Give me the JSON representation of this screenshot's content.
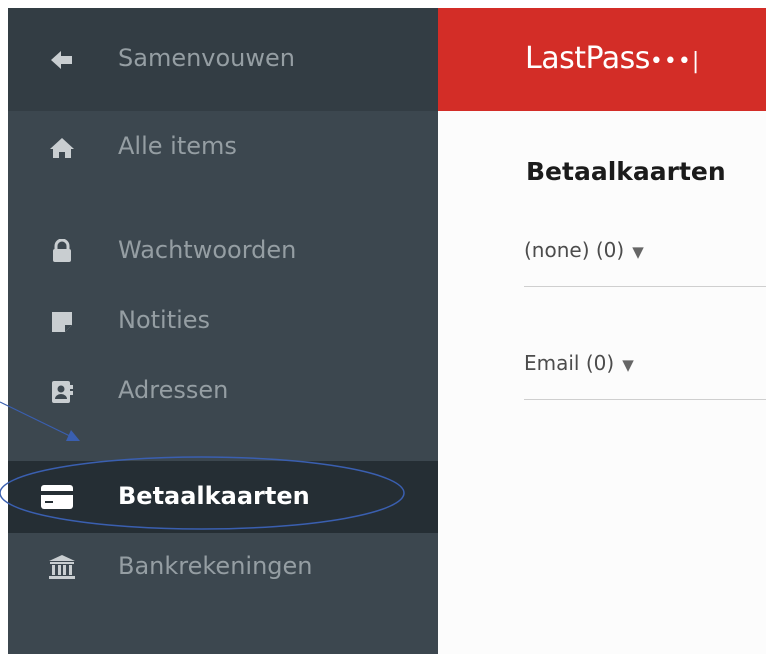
{
  "sidebar": {
    "collapse_label": "Samenvouwen",
    "items": [
      {
        "label": "Alle items",
        "icon": "home-icon"
      },
      {
        "label": "Wachtwoorden",
        "icon": "lock-icon"
      },
      {
        "label": "Notities",
        "icon": "note-icon"
      },
      {
        "label": "Adressen",
        "icon": "address-book-icon"
      },
      {
        "label": "Betaalkaarten",
        "icon": "credit-card-icon",
        "active": true
      },
      {
        "label": "Bankrekeningen",
        "icon": "bank-icon"
      }
    ]
  },
  "header": {
    "logo_text": "LastPass",
    "logo_suffix": "•••|"
  },
  "main": {
    "title": "Betaalkaarten",
    "filters": [
      {
        "label": "(none) (0)",
        "caret": "▼"
      },
      {
        "label": "Email (0)",
        "caret": "▼"
      }
    ]
  },
  "colors": {
    "brand_red": "#d32d27",
    "sidebar_bg": "#3c474f",
    "sidebar_active": "#252e34",
    "annotation_blue": "#3a5fb0"
  }
}
